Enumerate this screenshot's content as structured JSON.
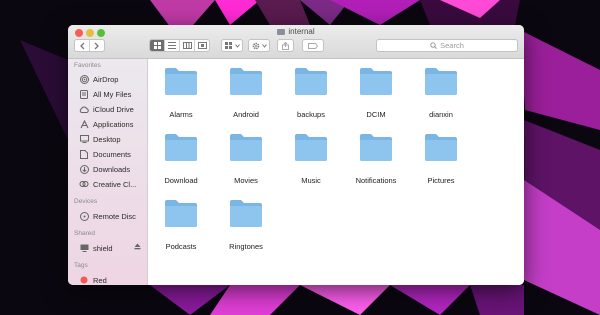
{
  "window": {
    "title": "internal"
  },
  "toolbar": {
    "back": "back",
    "forward": "forward",
    "view_modes": [
      "icon-view",
      "list-view",
      "column-view",
      "cover-flow-view"
    ],
    "arrange": "arrange",
    "action": "action",
    "share": "share",
    "tags": "tags",
    "search_placeholder": "Search"
  },
  "sidebar": {
    "sections": [
      {
        "header": "Favorites",
        "items": [
          {
            "label": "AirDrop",
            "icon": "airdrop-icon"
          },
          {
            "label": "All My Files",
            "icon": "all-files-icon"
          },
          {
            "label": "iCloud Drive",
            "icon": "cloud-icon"
          },
          {
            "label": "Applications",
            "icon": "applications-icon"
          },
          {
            "label": "Desktop",
            "icon": "desktop-icon"
          },
          {
            "label": "Documents",
            "icon": "documents-icon"
          },
          {
            "label": "Downloads",
            "icon": "downloads-icon"
          },
          {
            "label": "Creative Cl...",
            "icon": "creative-cloud-icon"
          }
        ]
      },
      {
        "header": "Devices",
        "items": [
          {
            "label": "Remote Disc",
            "icon": "disc-icon"
          }
        ]
      },
      {
        "header": "Shared",
        "items": [
          {
            "label": "shield",
            "icon": "computer-icon"
          }
        ]
      },
      {
        "header": "Tags",
        "items": [
          {
            "label": "Red",
            "icon": "tag-red-icon"
          }
        ]
      }
    ]
  },
  "folders": [
    {
      "name": "Alarms"
    },
    {
      "name": "Android"
    },
    {
      "name": "backups"
    },
    {
      "name": "DCIM"
    },
    {
      "name": "dianxin"
    },
    {
      "name": "Download"
    },
    {
      "name": "Movies"
    },
    {
      "name": "Music"
    },
    {
      "name": "Notifications"
    },
    {
      "name": "Pictures"
    },
    {
      "name": "Podcasts"
    },
    {
      "name": "Ringtones"
    }
  ],
  "colors": {
    "folder": "#8ec5ee",
    "folder_tab": "#7ab6e3",
    "red_tag": "#f05a4f"
  }
}
